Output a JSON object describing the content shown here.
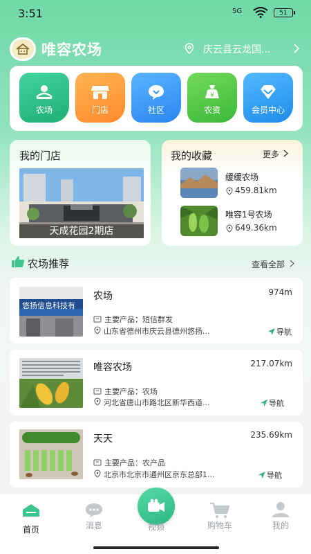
{
  "status": {
    "time": "3:51",
    "signal": "5G",
    "battery": "51"
  },
  "header": {
    "app_name": "唯容农场",
    "location": "庆云县云龙国..."
  },
  "categories": [
    {
      "label": "农场",
      "icon": "farm-icon",
      "color": "#2fc08a"
    },
    {
      "label": "门店",
      "icon": "store-icon",
      "color": "#ff9a3c"
    },
    {
      "label": "社区",
      "icon": "chat-bubble-icon",
      "color": "#3d9bf5"
    },
    {
      "label": "农资",
      "icon": "money-bag-icon",
      "color": "#57c93d"
    },
    {
      "label": "会员中心",
      "icon": "diamond-icon",
      "color": "#2c9ef2"
    }
  ],
  "my_store": {
    "title": "我的门店",
    "name": "天成花园2期店"
  },
  "favorites": {
    "title": "我的收藏",
    "more": "更多",
    "items": [
      {
        "name": "缓缓农场",
        "distance": "459.81km"
      },
      {
        "name": "唯容1号农场",
        "distance": "649.36km"
      }
    ]
  },
  "recommend": {
    "title": "农场推荐",
    "view_all": "查看全部"
  },
  "farms": [
    {
      "name": "农场",
      "distance": "974m",
      "product": "主要产品：短信群发",
      "address": "山东省德州市庆云县德州悠扬...",
      "nav": "导航",
      "banner": "悠扬信息科技有"
    },
    {
      "name": "唯容农场",
      "distance": "217.07km",
      "product": "主要产品：农场",
      "address": "河北省唐山市路北区新华西道...",
      "nav": "导航"
    },
    {
      "name": "天天",
      "distance": "235.69km",
      "product": "主要产品：农产品",
      "address": "北京市北京市通州区京东总部1...",
      "nav": "导航"
    }
  ],
  "tabs": [
    {
      "label": "首页",
      "active": true
    },
    {
      "label": "消息",
      "active": false
    },
    {
      "label": "视频",
      "active": false
    },
    {
      "label": "购物车",
      "active": false
    },
    {
      "label": "我的",
      "active": false
    }
  ]
}
